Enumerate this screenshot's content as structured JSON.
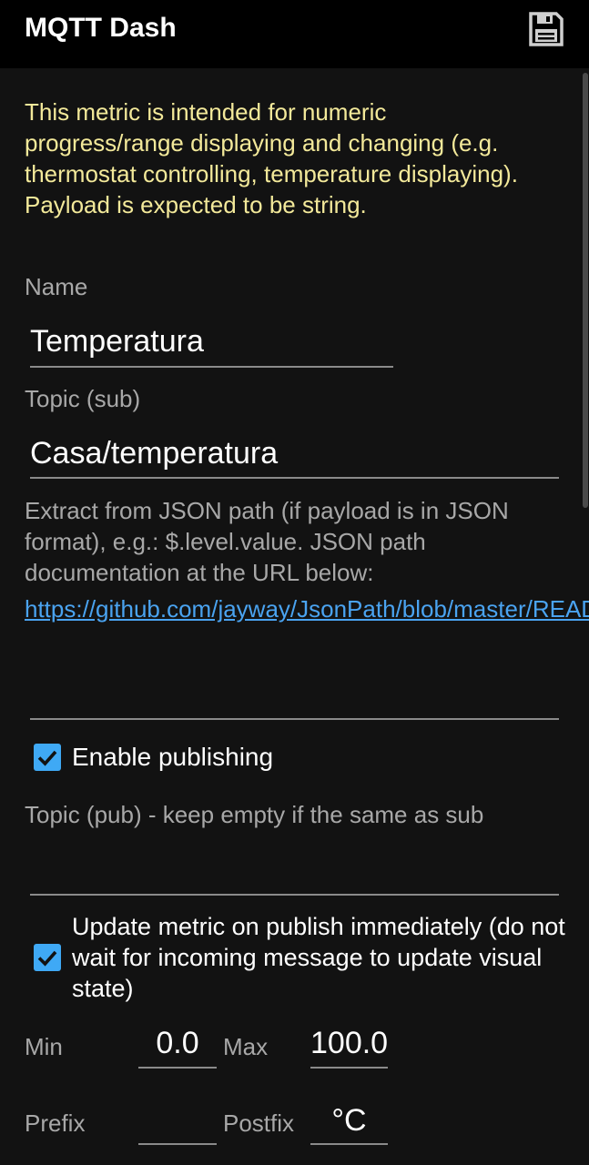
{
  "appbar": {
    "title": "MQTT Dash",
    "save_icon": "floppy-disk-icon"
  },
  "intro_text": "This metric is intended for numeric progress/range displaying and changing (e.g. thermostat controlling, temperature displaying). Payload is expected to be string.",
  "name": {
    "label": "Name",
    "value": "Temperatura"
  },
  "topic_sub": {
    "label": "Topic (sub)",
    "value": "Casa/temperatura"
  },
  "json_path": {
    "help": "Extract from JSON path (if payload is in JSON format), e.g.: $.level.value. JSON path documentation at the URL below:",
    "link": "https://github.com/jayway/JsonPath/blob/master/README.md",
    "value": ""
  },
  "enable_publishing": {
    "label": "Enable publishing",
    "checked": true
  },
  "topic_pub": {
    "label": "Topic (pub) - keep empty if the same as sub",
    "value": ""
  },
  "update_immediately": {
    "label": "Update metric on publish immediately (do not wait for incoming message to update visual state)",
    "checked": true
  },
  "range": {
    "min_label": "Min",
    "min_value": "0.0",
    "max_label": "Max",
    "max_value": "100.0"
  },
  "affixes": {
    "prefix_label": "Prefix",
    "prefix_value": "",
    "postfix_label": "Postfix",
    "postfix_value": "°C"
  },
  "colors": {
    "background": "#121212",
    "appbar": "#000000",
    "intro_text": "#f3e99a",
    "accent": "#3fa9f5",
    "link": "#4aa3f0"
  }
}
